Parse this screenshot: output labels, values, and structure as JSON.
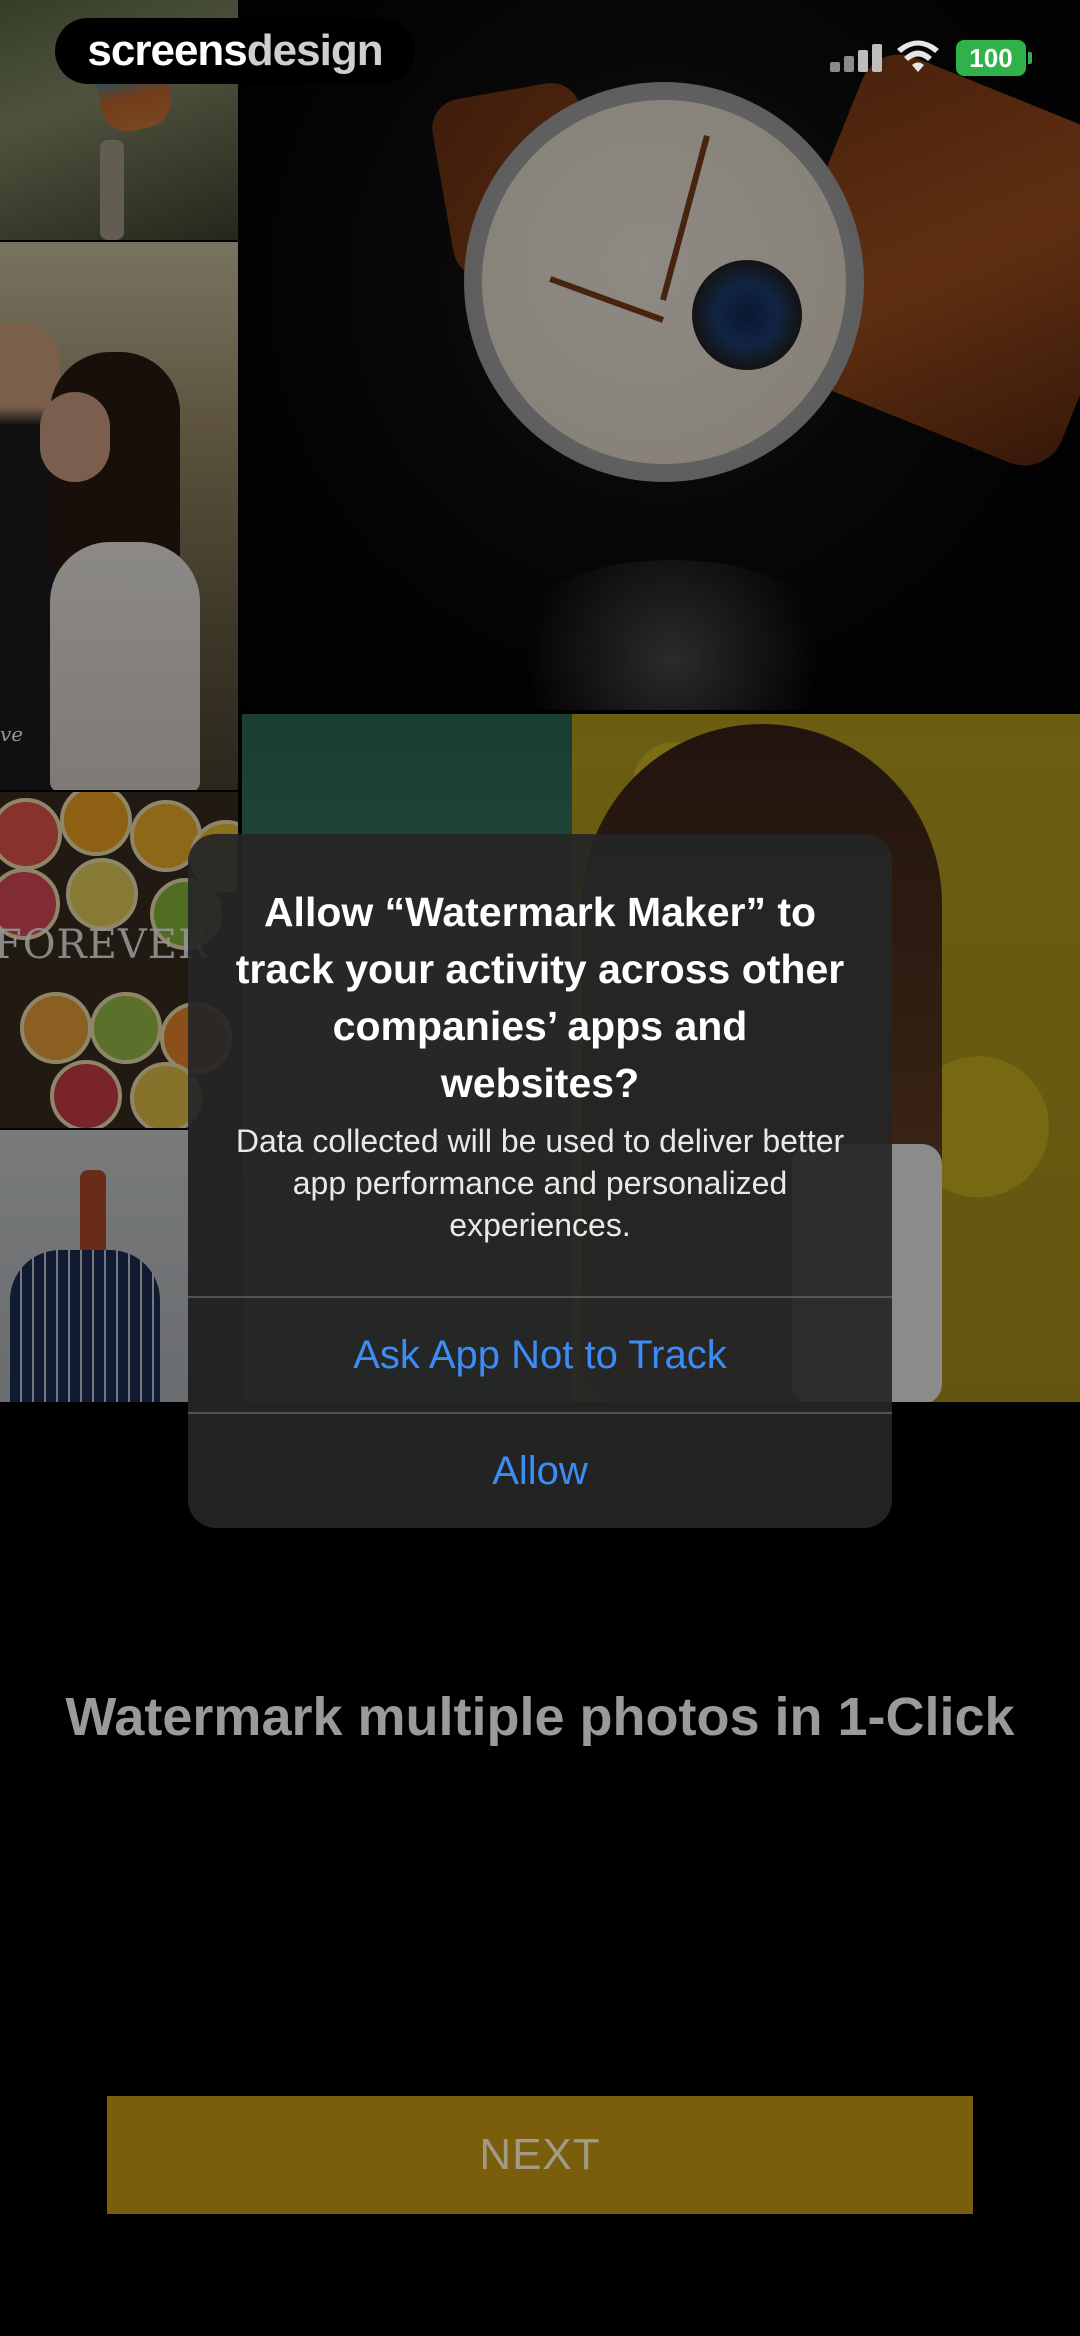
{
  "status_bar": {
    "brand_part1": "screens",
    "brand_part2": "design",
    "battery_level": "100",
    "signal_icon": "signal-bars-icon",
    "wifi_icon": "wifi-icon",
    "battery_color": "#31b14a"
  },
  "collage": {
    "couple_caption": "ve",
    "citrus_caption": "FOREVER"
  },
  "alert": {
    "title": "Allow “Watermark Maker” to track your activity across other companies’ apps and websites?",
    "message": "Data collected will be used to deliver better app performance and personalized experiences.",
    "buttons": [
      {
        "label": "Ask App Not to Track"
      },
      {
        "label": "Allow"
      }
    ],
    "button_color": "#3b8cf5"
  },
  "onboarding": {
    "headline": "Watermark multiple photos in 1-Click",
    "next_label": "NEXT",
    "next_color": "#7a5e0b"
  }
}
